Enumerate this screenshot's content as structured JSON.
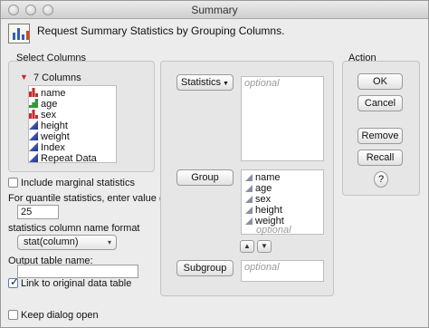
{
  "window": {
    "title": "Summary"
  },
  "header": {
    "text": "Request Summary Statistics by Grouping Columns."
  },
  "select_columns": {
    "title": "Select Columns",
    "count_label": "7 Columns",
    "columns": [
      {
        "name": "name",
        "type": "nominal"
      },
      {
        "name": "age",
        "type": "ordinal"
      },
      {
        "name": "sex",
        "type": "nominal"
      },
      {
        "name": "height",
        "type": "continuous"
      },
      {
        "name": "weight",
        "type": "continuous"
      },
      {
        "name": "Index",
        "type": "continuous"
      },
      {
        "name": "Repeat Data",
        "type": "continuous"
      }
    ]
  },
  "options": {
    "include_marginal_label": "Include marginal statistics",
    "quantile_label": "For quantile statistics, enter value (%)",
    "quantile_value": "25",
    "name_format_label": "statistics column name format",
    "name_format_value": "stat(column)",
    "output_table_label": "Output table name:",
    "output_table_value": "",
    "link_label": "Link to original data table",
    "keep_open_label": "Keep dialog open"
  },
  "roles": {
    "statistics_label": "Statistics",
    "statistics_placeholder": "optional",
    "group_label": "Group",
    "group_items": [
      "name",
      "age",
      "sex",
      "height",
      "weight"
    ],
    "group_placeholder": "optional",
    "subgroup_label": "Subgroup",
    "subgroup_placeholder": "optional"
  },
  "action": {
    "title": "Action",
    "ok": "OK",
    "cancel": "Cancel",
    "remove": "Remove",
    "recall": "Recall",
    "help": "?"
  }
}
